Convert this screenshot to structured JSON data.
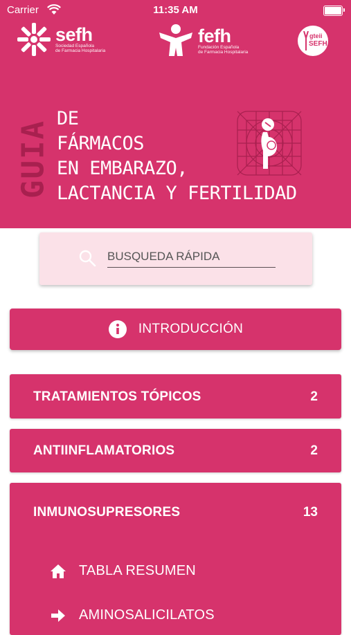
{
  "status_bar": {
    "carrier": "Carrier",
    "time": "11:35 AM"
  },
  "header": {
    "logos": [
      {
        "brand": "sefh",
        "subtitle_line1": "Sociedad Española",
        "subtitle_line2": "de Farmacia Hospitalaria"
      },
      {
        "brand": "fefh",
        "subtitle_line1": "Fundación Española",
        "subtitle_line2": "de Farmacia Hospitalaria"
      },
      {
        "line1": "gteii",
        "line2": "SEFH"
      }
    ],
    "vertical_word": "GUIA",
    "title_lines": [
      "DE",
      "FÁRMACOS",
      "EN EMBARAZO,",
      "LACTANCIA Y FERTILIDAD"
    ],
    "background_color": "#d6336c",
    "icon": "pregnant-woman-icon"
  },
  "search": {
    "placeholder": "BUSQUEDA RÁPIDA",
    "value": "",
    "icon": "search-icon"
  },
  "intro": {
    "label": "INTRODUCCIÓN",
    "icon": "info-icon"
  },
  "categories": [
    {
      "title": "TRATAMIENTOS TÓPICOS",
      "count": "2",
      "expanded": false
    },
    {
      "title": "ANTIINFLAMATORIOS",
      "count": "2",
      "expanded": false
    },
    {
      "title": "INMUNOSUPRESORES",
      "count": "13",
      "expanded": true,
      "items": [
        {
          "label": "TABLA RESUMEN",
          "icon": "home-icon"
        },
        {
          "label": "AMINOSALICILATOS",
          "icon": "arrow-right-icon"
        }
      ]
    }
  ],
  "colors": {
    "accent": "#d6336c",
    "accent_dark": "#a8204f",
    "search_bg": "#fbe1e8"
  }
}
